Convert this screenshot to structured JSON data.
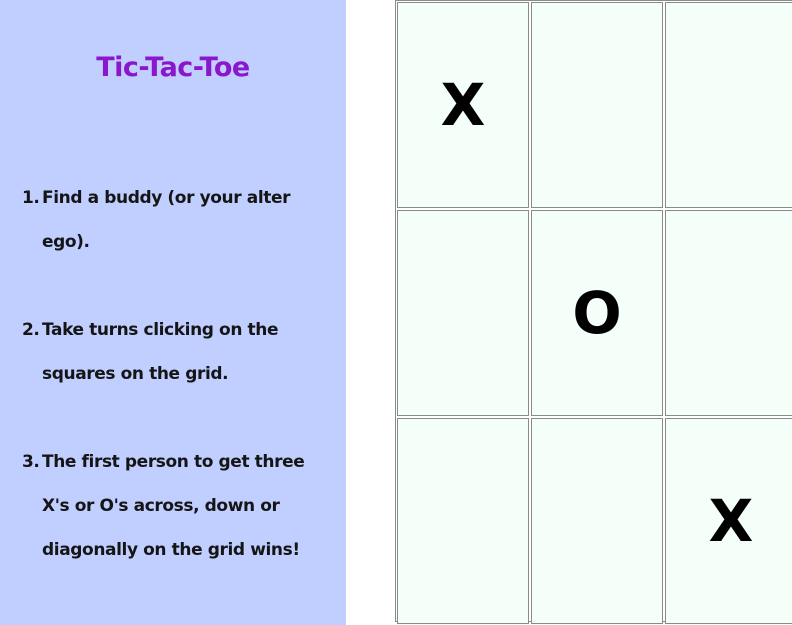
{
  "title": "Tic-Tac-Toe",
  "instructions": [
    {
      "num": "1.",
      "text": "Find a buddy (or your alter ego)."
    },
    {
      "num": "2.",
      "text": "Take turns clicking on the squares on the grid."
    },
    {
      "num": "3.",
      "text": "The first person to get three X's or O's across, down or diagonally on the grid wins!"
    }
  ],
  "board": {
    "cells": [
      "X",
      "",
      "",
      "",
      "O",
      "",
      "",
      "",
      "X"
    ]
  },
  "colors": {
    "sidebar_bg": "#c0cfff",
    "title": "#8a17cc",
    "cell_bg": "#f3fff8"
  }
}
